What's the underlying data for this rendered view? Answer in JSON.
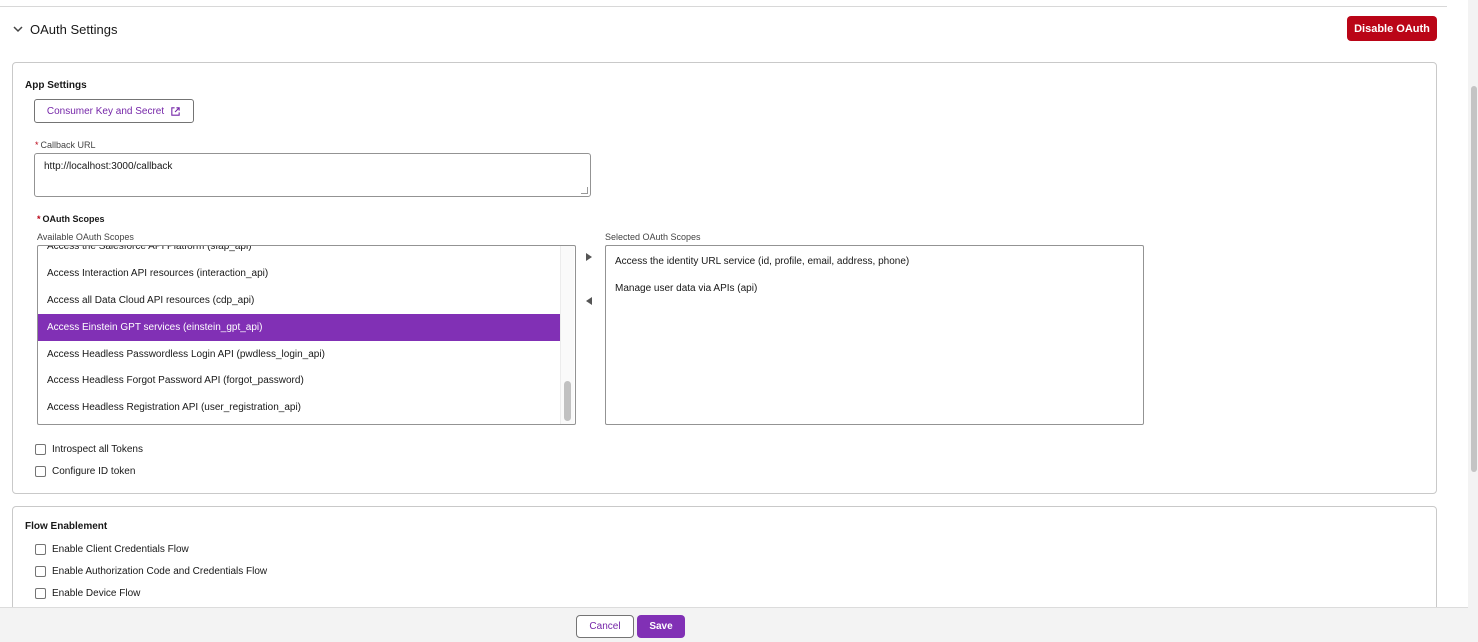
{
  "section": {
    "title": "OAuth Settings",
    "disable_label": "Disable OAuth"
  },
  "app_settings": {
    "title": "App Settings",
    "consumer_button_label": "Consumer Key and Secret",
    "callback": {
      "label": "Callback URL",
      "value": "http://localhost:3000/callback"
    },
    "scopes": {
      "label": "OAuth Scopes",
      "available_label": "Available OAuth Scopes",
      "selected_label": "Selected OAuth Scopes",
      "available": [
        "Access the Salesforce API Platform (sfap_api)",
        "Access Interaction API resources (interaction_api)",
        "Access all Data Cloud API resources (cdp_api)",
        "Access Einstein GPT services (einstein_gpt_api)",
        "Access Headless Passwordless Login API (pwdless_login_api)",
        "Access Headless Forgot Password API (forgot_password)",
        "Access Headless Registration API (user_registration_api)"
      ],
      "available_highlighted": "Access Einstein GPT services (einstein_gpt_api)",
      "selected": [
        "Access the identity URL service (id, profile, email, address, phone)",
        "Manage user data via APIs (api)"
      ]
    },
    "checkboxes": [
      {
        "label": "Introspect all Tokens",
        "checked": false
      },
      {
        "label": "Configure ID token",
        "checked": false
      }
    ]
  },
  "flow": {
    "title": "Flow Enablement",
    "checkboxes": [
      {
        "label": "Enable Client Credentials Flow",
        "checked": false
      },
      {
        "label": "Enable Authorization Code and Credentials Flow",
        "checked": false
      },
      {
        "label": "Enable Device Flow",
        "checked": false
      }
    ]
  },
  "footer": {
    "cancel_label": "Cancel",
    "save_label": "Save"
  },
  "colors": {
    "brand": "#8130b5",
    "danger": "#ba0517",
    "link": "#7526a8"
  }
}
